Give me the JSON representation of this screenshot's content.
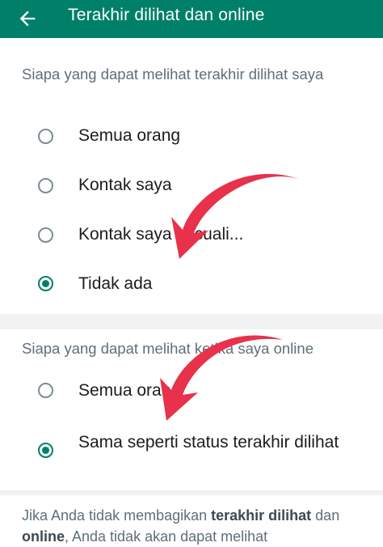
{
  "appbar": {
    "title": "Terakhir dilihat dan online",
    "back_icon": "arrow-left-icon",
    "color": "#008069"
  },
  "last_seen": {
    "header": "Siapa yang dapat melihat terakhir dilihat saya",
    "options": [
      {
        "label": "Semua orang",
        "checked": false
      },
      {
        "label": "Kontak saya",
        "checked": false
      },
      {
        "label": "Kontak saya kecuali...",
        "checked": false
      },
      {
        "label": "Tidak ada",
        "checked": true
      }
    ]
  },
  "online": {
    "header": "Siapa yang dapat melihat ketika saya online",
    "options": [
      {
        "label": "Semua orang",
        "checked": false
      },
      {
        "label": "Sama seperti status terakhir dilihat",
        "checked": true
      }
    ]
  },
  "footer": {
    "part1": "Jika Anda tidak membagikan ",
    "bold1": "terakhir dilihat",
    "part2": " dan ",
    "bold2": "online",
    "part3": ", Anda tidak akan dapat melihat"
  },
  "annotation": {
    "arrow_color": "#e8314a"
  }
}
